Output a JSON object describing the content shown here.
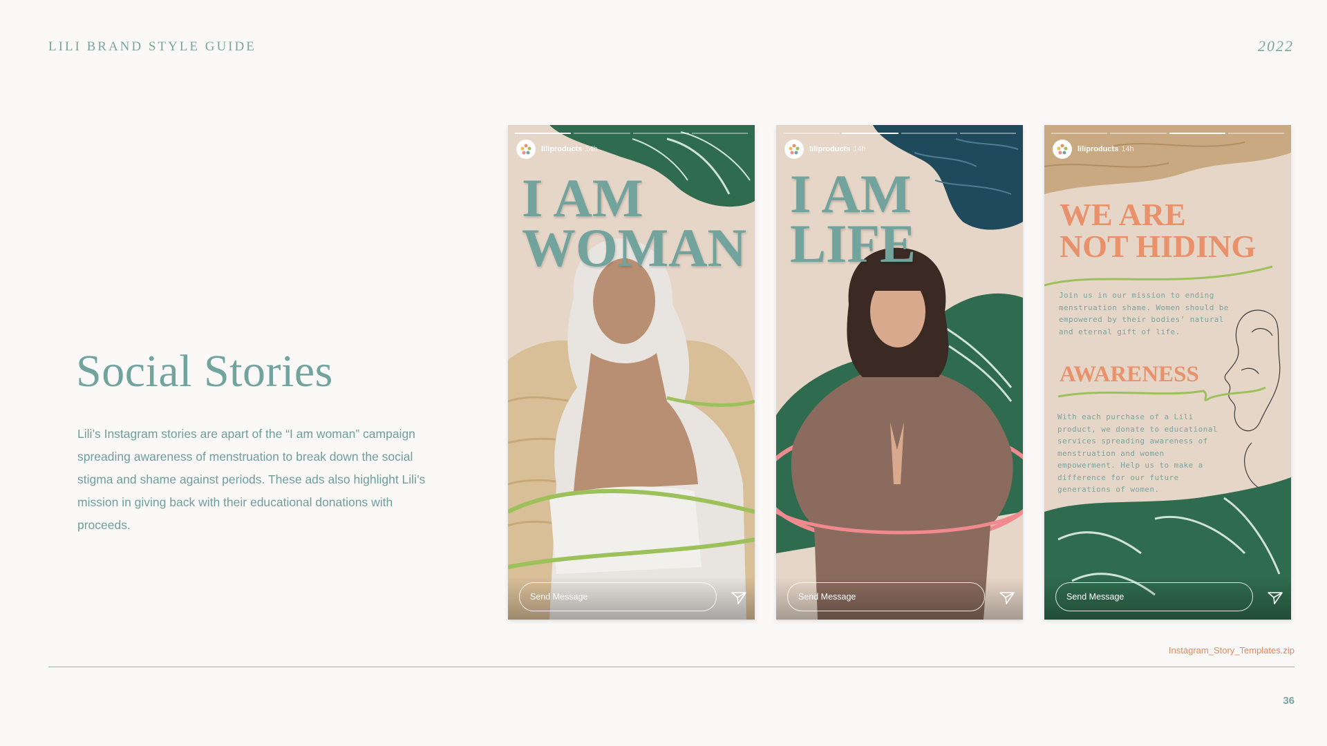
{
  "header": {
    "brand_title": "LILI BRAND STYLE GUIDE",
    "year": "2022"
  },
  "section": {
    "title": "Social Stories",
    "body": "Lili’s Instagram stories are apart of the “I am woman” campaign spreading awareness of menstruation to break down the social stigma and shame against periods. These ads also highlight Lili’s mission in giving back with their educational donations with proceeds."
  },
  "stories": [
    {
      "account": "liliproducts",
      "time": "14h",
      "headline_line1": "I AM",
      "headline_line2": "WOMAN",
      "send_placeholder": "Send Message",
      "active_segment": 0
    },
    {
      "account": "liliproducts",
      "time": "14h",
      "headline_line1": "I AM",
      "headline_line2": "LIFE",
      "send_placeholder": "Send Message",
      "active_segment": 1
    },
    {
      "account": "liliproducts",
      "time": "14h",
      "heading_line1": "WE ARE",
      "heading_line2": "NOT HIDING",
      "paragraph1": "Join us in our mission to ending menstruation shame. Women should be empowered by their bodies’ natural and eternal gift of life.",
      "subheading": "AWARENESS",
      "paragraph2": "With each purchase of a Lili product, we donate to educational services spreading awareness of menstruation and women empowerment. Help us to make a difference for our future generations of women.",
      "send_placeholder": "Send Message",
      "active_segment": 2
    }
  ],
  "footer": {
    "download_link": "Instagram_Story_Templates.zip",
    "page_number": "36"
  },
  "colors": {
    "teal": "#72a39d",
    "coral": "#e9916a",
    "story_bg": "#e6d6c8",
    "leaf_green": "#2f6b4e",
    "accent_green": "#9cc15a",
    "pink_ring": "#f08a8f"
  },
  "icons": [
    "lili-logo-icon",
    "send-plane-icon"
  ]
}
